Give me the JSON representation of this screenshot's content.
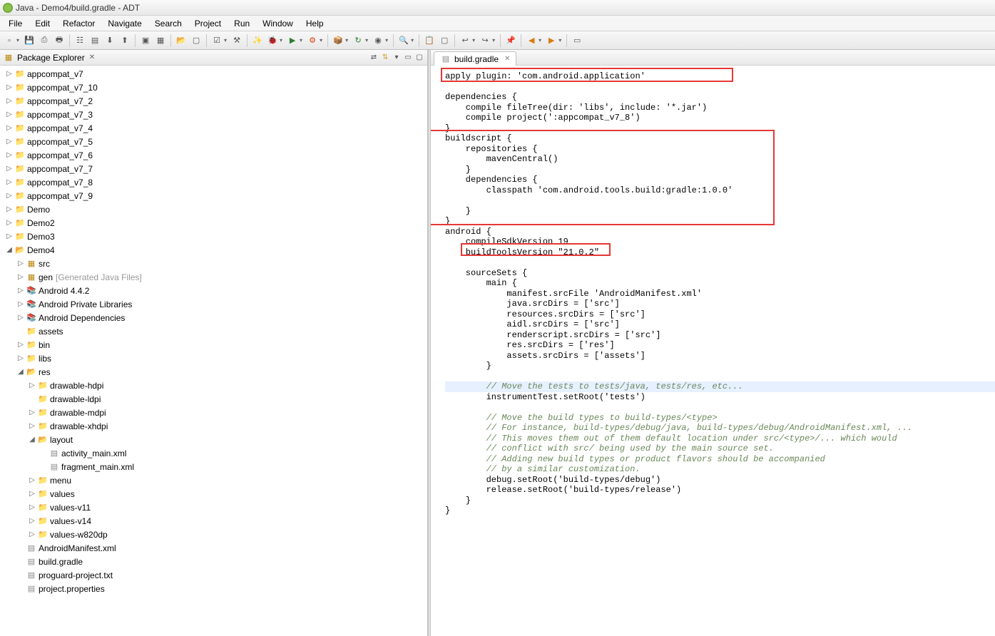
{
  "titlebar": "Java - Demo4/build.gradle - ADT",
  "menu": [
    "File",
    "Edit",
    "Refactor",
    "Navigate",
    "Search",
    "Project",
    "Run",
    "Window",
    "Help"
  ],
  "package_explorer": {
    "title": "Package Explorer",
    "projects_closed": [
      "appcompat_v7",
      "appcompat_v7_10",
      "appcompat_v7_2",
      "appcompat_v7_3",
      "appcompat_v7_4",
      "appcompat_v7_5",
      "appcompat_v7_6",
      "appcompat_v7_7",
      "appcompat_v7_8",
      "appcompat_v7_9",
      "Demo",
      "Demo2",
      "Demo3"
    ],
    "open_project": {
      "name": "Demo4",
      "src": "src",
      "gen": "gen",
      "gen_suffix": "[Generated Java Files]",
      "android_lib": "Android 4.4.2",
      "private_libs": "Android Private Libraries",
      "dependencies": "Android Dependencies",
      "assets": "assets",
      "bin": "bin",
      "libs": "libs",
      "res": {
        "label": "res",
        "folders": [
          "drawable-hdpi",
          "drawable-ldpi",
          "drawable-mdpi",
          "drawable-xhdpi"
        ],
        "layout": {
          "label": "layout",
          "files": [
            "activity_main.xml",
            "fragment_main.xml"
          ]
        },
        "rest": [
          "menu",
          "values",
          "values-v11",
          "values-v14",
          "values-w820dp"
        ]
      },
      "files": [
        "AndroidManifest.xml",
        "build.gradle",
        "proguard-project.txt",
        "project.properties"
      ]
    }
  },
  "editor": {
    "tab": "build.gradle",
    "lines": [
      "apply plugin: 'com.android.application'",
      "",
      "dependencies {",
      "    compile fileTree(dir: 'libs', include: '*.jar')",
      "    compile project(':appcompat_v7_8')",
      "}",
      "buildscript {",
      "    repositories {",
      "        mavenCentral()",
      "    }",
      "    dependencies {",
      "        classpath 'com.android.tools.build:gradle:1.0.0'",
      "",
      "    }",
      "}",
      "android {",
      "    compileSdkVersion 19",
      "    buildToolsVersion \"21.0.2\"",
      "",
      "    sourceSets {",
      "        main {",
      "            manifest.srcFile 'AndroidManifest.xml'",
      "            java.srcDirs = ['src']",
      "            resources.srcDirs = ['src']",
      "            aidl.srcDirs = ['src']",
      "            renderscript.srcDirs = ['src']",
      "            res.srcDirs = ['res']",
      "            assets.srcDirs = ['assets']",
      "        }",
      "",
      "        // Move the tests to tests/java, tests/res, etc...",
      "        instrumentTest.setRoot('tests')",
      "",
      "        // Move the build types to build-types/<type>",
      "        // For instance, build-types/debug/java, build-types/debug/AndroidManifest.xml, ...",
      "        // This moves them out of them default location under src/<type>/... which would",
      "        // conflict with src/ being used by the main source set.",
      "        // Adding new build types or product flavors should be accompanied",
      "        // by a similar customization.",
      "        debug.setRoot('build-types/debug')",
      "        release.setRoot('build-types/release')",
      "    }",
      "}"
    ],
    "comment_lines": [
      30,
      33,
      34,
      35,
      36,
      37,
      38
    ],
    "highlight_line": 30
  }
}
